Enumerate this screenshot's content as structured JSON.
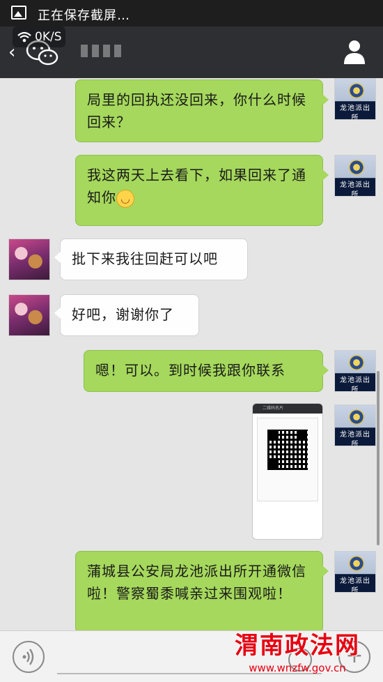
{
  "status_bar": {
    "notification": "正在保存截屏…",
    "net_speed": "0K/S"
  },
  "header": {
    "back_glyph": "‹",
    "contact_name_masked": true
  },
  "messages": [
    {
      "side": "out",
      "text": "局里的回执还没回来，你什么时候回来？",
      "sender": "龙池派出所"
    },
    {
      "side": "out",
      "text": "我这两天上去看下，如果回来了通知你",
      "emoji": "smile",
      "sender": "龙池派出所"
    },
    {
      "side": "in",
      "text": "批下来我往回赶可以吧",
      "sender": "user"
    },
    {
      "side": "in",
      "text": "好吧，谢谢你了",
      "sender": "user"
    },
    {
      "side": "out",
      "text": "嗯！可以。到时候我跟你联系",
      "sender": "龙池派出所"
    },
    {
      "side": "out",
      "type": "image",
      "caption": "二维码名片",
      "sender": "龙池派出所"
    },
    {
      "side": "out",
      "text": "蒲城县公安局龙池派出所开通微信啦！警察蜀黍喊亲过来围观啦！",
      "sender": "龙池派出所"
    }
  ],
  "input": {
    "placeholder": ""
  },
  "watermark": {
    "title": "渭南政法网",
    "url": "www.wnzfw.gov.cn"
  },
  "colors": {
    "out_bubble": "#a5d85c",
    "in_bubble": "#fefefe",
    "title_bar": "#2d2f33",
    "watermark_red": "#e60012"
  }
}
